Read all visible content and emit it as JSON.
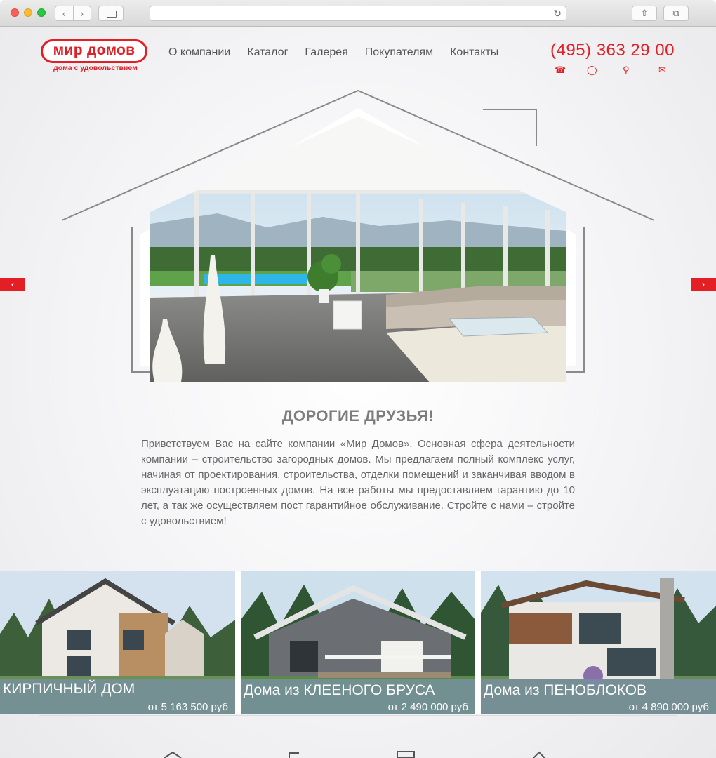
{
  "brand": {
    "name": "мир домов",
    "tagline": "дома с удовольствием",
    "accent": "#e31e24"
  },
  "nav": {
    "items": [
      "О компании",
      "Каталог",
      "Галерея",
      "Покупателям",
      "Контакты"
    ]
  },
  "header": {
    "phone": "(495) 363 29 00",
    "icons": [
      "phone-callback-icon",
      "chat-icon",
      "search-icon",
      "mail-icon"
    ]
  },
  "slider": {
    "prev_icon": "chevron-left-icon",
    "next_icon": "chevron-right-icon"
  },
  "intro": {
    "heading": "ДОРОГИЕ ДРУЗЬЯ!",
    "text": "Приветствуем Вас на сайте компании «Мир Домов». Основная сфера деятельности компании – строительство загородных домов. Мы предлагаем полный комплекс услуг, начиная от проектирования, строительства, отделки помещений и заканчивая вводом в эксплуатацию построенных домов. На все работы мы предоставляем гарантию до 10 лет, а так же осуществляем пост гарантийное обслуживание.  Стройте с нами – стройте с удовольствием!"
  },
  "catalog": [
    {
      "title": "КИРПИЧНЫЙ ДОМ",
      "price": "от 5 163 500 руб"
    },
    {
      "title": "Дома из КЛЕЕНОГО БРУСА",
      "price": "от 2 490 000 руб"
    },
    {
      "title": "Дома из ПЕНОБЛОКОВ",
      "price": "от 4 890 000 руб"
    }
  ]
}
